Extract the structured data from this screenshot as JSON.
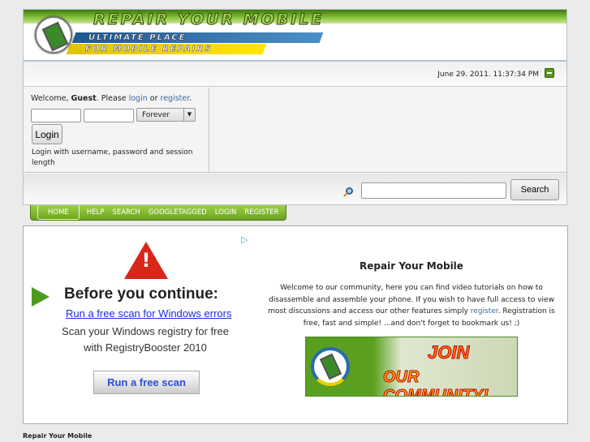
{
  "header": {
    "logo_title": "REPAIR YOUR MOBILE",
    "logo_tagline_1": "ULTIMATE PLACE",
    "logo_tagline_2": "FOR MOBILE REPAIRS",
    "datetime": "June 29. 2011. 11:37:34 PM",
    "brand_color": "#6aa31c"
  },
  "login": {
    "welcome_prefix": "Welcome, ",
    "guest": "Guest",
    "please": ". Please ",
    "login_link": "login",
    "or": " or ",
    "register_link": "register",
    "period": ".",
    "session_select": "Forever",
    "login_button": "Login",
    "hint": "Login with username, password and session length"
  },
  "search": {
    "button": "Search",
    "value": ""
  },
  "nav": {
    "items": [
      {
        "label": "HOME",
        "active": true
      },
      {
        "label": "HELP"
      },
      {
        "label": "SEARCH"
      },
      {
        "label": "GOOGLETAGGED"
      },
      {
        "label": "LOGIN"
      },
      {
        "label": "REGISTER"
      }
    ]
  },
  "ad": {
    "headline": "Before you continue:",
    "link": "Run a free scan for Windows errors",
    "line1": "Scan your Windows registry for free",
    "line2": "with RegistryBooster 2010",
    "button": "Run a free scan"
  },
  "welcome": {
    "title": "Repair Your Mobile",
    "text_before": "Welcome to our community, here you can find video tutorials on how to disassemble and assemble your phone. If you wish to have full access to view most discussions and access our other features simply ",
    "register_link": "register",
    "text_after": ". Registration is free, fast and simple! ...and don't forget to bookmark us! ;)",
    "banner_line1": "JOIN",
    "banner_line2": "OUR COMMUNITY!"
  },
  "footer": {
    "text": "Repair Your Mobile"
  }
}
